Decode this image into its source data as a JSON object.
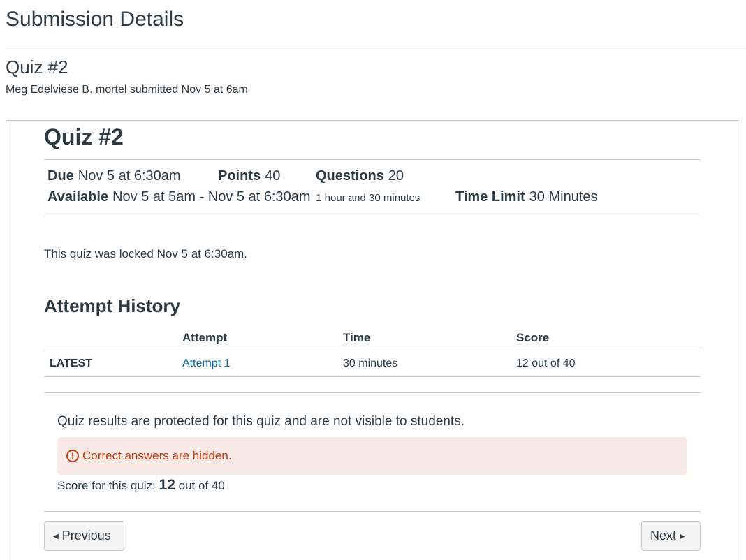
{
  "page": {
    "title": "Submission Details",
    "quiz_name": "Quiz #2",
    "submitted_line": "Meg Edelviese B. mortel submitted Nov 5 at 6am"
  },
  "quiz": {
    "title": "Quiz #2",
    "due_label": "Due",
    "due_value": "Nov 5 at 6:30am",
    "points_label": "Points",
    "points_value": "40",
    "questions_label": "Questions",
    "questions_value": "20",
    "available_label": "Available",
    "available_value": "Nov 5 at 5am - Nov 5 at 6:30am",
    "available_duration": "1 hour and 30 minutes",
    "time_limit_label": "Time Limit",
    "time_limit_value": "30 Minutes",
    "locked_message": "This quiz was locked Nov 5 at 6:30am."
  },
  "attempt_history": {
    "heading": "Attempt History",
    "columns": [
      "",
      "Attempt",
      "Time",
      "Score"
    ],
    "rows": [
      {
        "label": "LATEST",
        "attempt": "Attempt 1",
        "time": "30 minutes",
        "score": "12 out of 40"
      }
    ]
  },
  "results": {
    "protected_text": "Quiz results are protected for this quiz and are not visible to students.",
    "alert_icon": "!",
    "alert_text": "Correct answers are hidden.",
    "score_prefix": "Score for this quiz:",
    "score_value": "12",
    "score_suffix": "out of 40"
  },
  "nav": {
    "previous_label": "Previous",
    "next_label": "Next"
  },
  "colors": {
    "link": "#0770a3",
    "alert_bg": "#f8e8e6",
    "alert_text": "#c23c0d"
  }
}
